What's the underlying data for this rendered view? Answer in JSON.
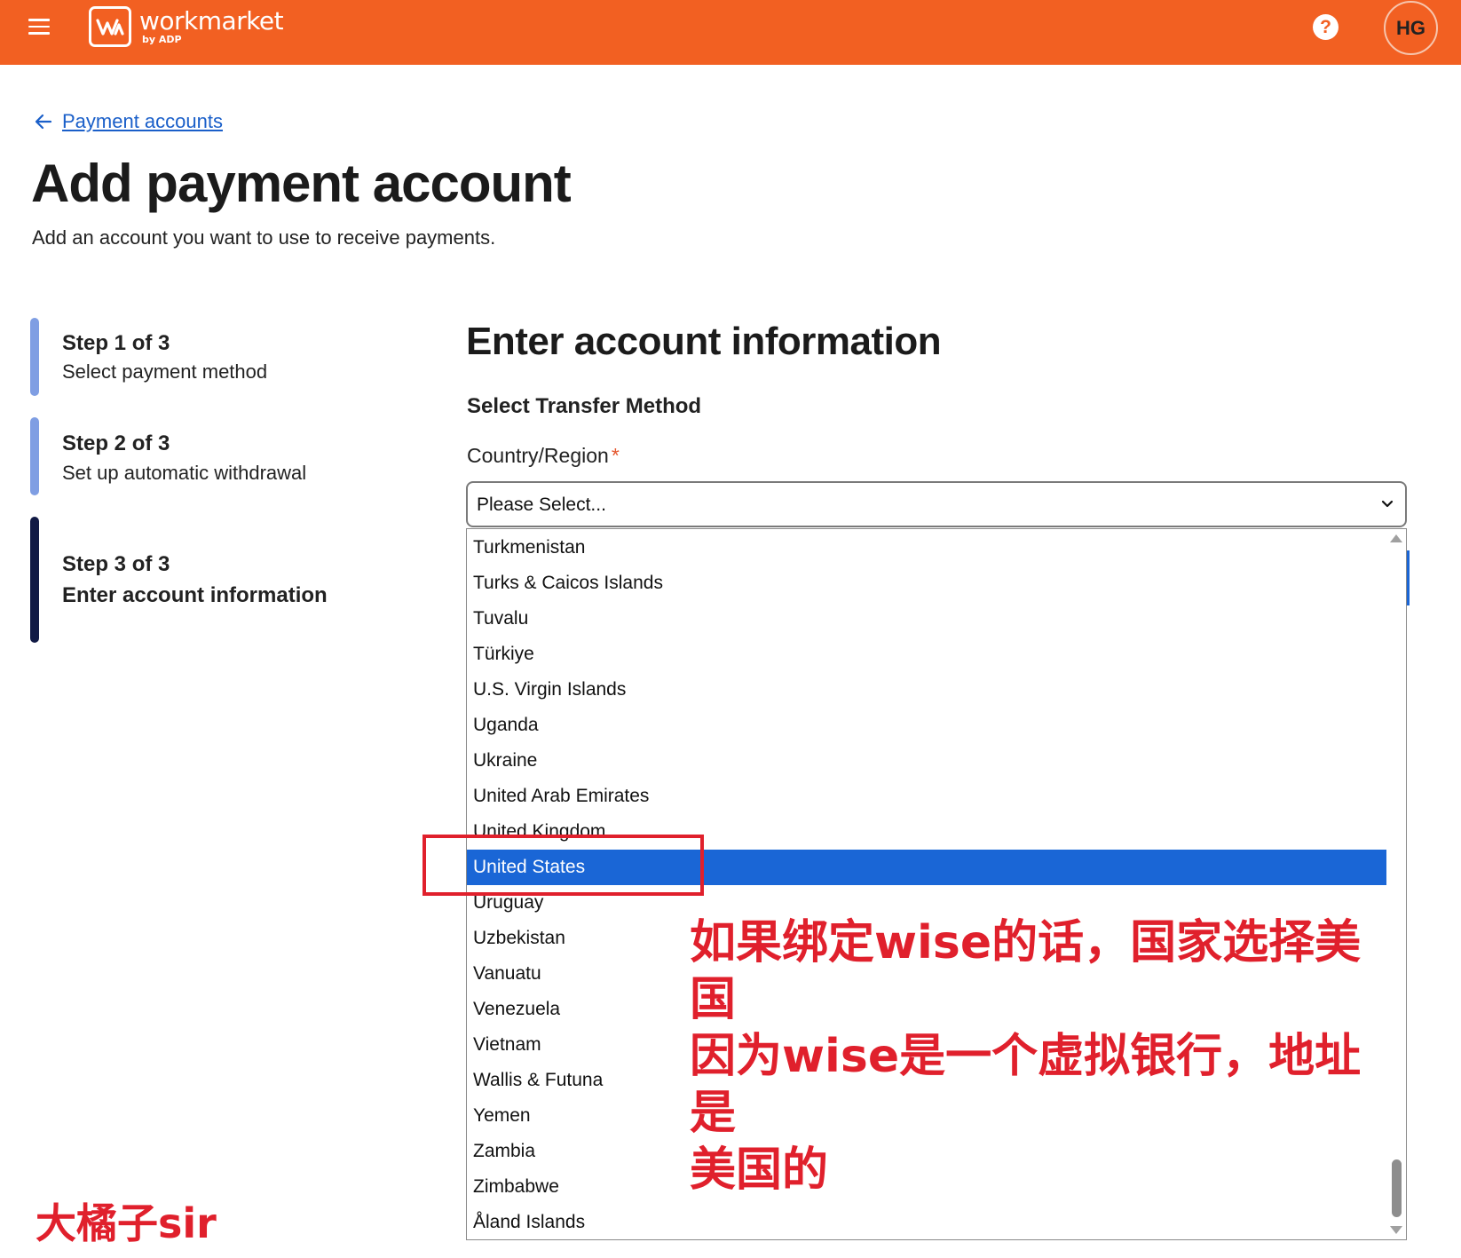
{
  "header": {
    "brand_name": "workmarket",
    "brand_sub": "by ADP",
    "help_glyph": "?",
    "avatar_initials": "HG"
  },
  "page": {
    "back_link": "Payment accounts",
    "title": "Add payment account",
    "subtitle": "Add an account you want to use to receive payments."
  },
  "steps": [
    {
      "title": "Step 1 of 3",
      "desc": "Select payment method",
      "state": "done"
    },
    {
      "title": "Step 2 of 3",
      "desc": "Set up automatic withdrawal",
      "state": "done"
    },
    {
      "title": "Step 3 of 3",
      "desc": "Enter account information",
      "state": "current"
    }
  ],
  "form": {
    "section_title": "Enter account information",
    "transfer_label": "Select Transfer Method",
    "country_label": "Country/Region",
    "required_mark": "*",
    "select_value": "Please Select..."
  },
  "country_options": [
    "Turkmenistan",
    "Turks & Caicos Islands",
    "Tuvalu",
    "Türkiye",
    "U.S. Virgin Islands",
    "Uganda",
    "Ukraine",
    "United Arab Emirates",
    "United Kingdom",
    "United States",
    "Uruguay",
    "Uzbekistan",
    "Vanuatu",
    "Venezuela",
    "Vietnam",
    "Wallis & Futuna",
    "Yemen",
    "Zambia",
    "Zimbabwe",
    "Åland Islands"
  ],
  "highlighted_option": "United States",
  "annotation": {
    "line1": "如果绑定wise的话，国家选择美国",
    "line2": "因为wise是一个虚拟银行，地址是",
    "line3": "美国的"
  },
  "watermark": "大橘子sir",
  "colors": {
    "brand_orange": "#f26022",
    "link_blue": "#1a5fc9",
    "selected_blue": "#1a66d6",
    "step_done": "#7f9ee3",
    "step_current": "#111a45",
    "annotation_red": "#e0202c"
  }
}
